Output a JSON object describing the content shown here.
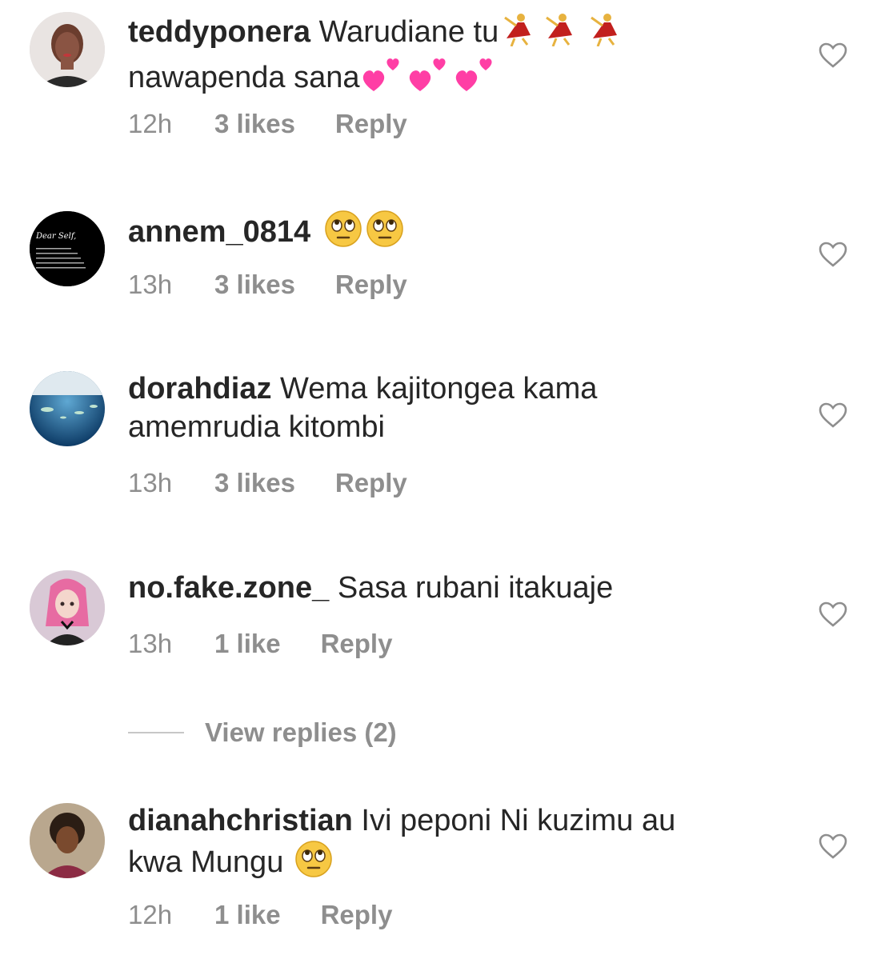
{
  "comments": [
    {
      "username": "teddyponera",
      "text_line1": "Warudiane tu",
      "text_line2": "nawapenda sana",
      "emoji_line1": [
        "dancer",
        "dancer",
        "dancer"
      ],
      "emoji_line2": [
        "two-hearts",
        "two-hearts",
        "two-hearts"
      ],
      "time": "12h",
      "likes": "3 likes",
      "reply": "Reply"
    },
    {
      "username": "annem_0814",
      "text_line1": "",
      "emoji_line1": [
        "rolling-eyes",
        "rolling-eyes"
      ],
      "avatar_title": "Dear Self,",
      "time": "13h",
      "likes": "3 likes",
      "reply": "Reply"
    },
    {
      "username": "dorahdiaz",
      "text_line1": "Wema kajitongea kama",
      "text_line2": "amemrudia kitombi",
      "time": "13h",
      "likes": "3 likes",
      "reply": "Reply"
    },
    {
      "username": "no.fake.zone_",
      "text_line1": "Sasa rubani itakuaje",
      "time": "13h",
      "likes": "1 like",
      "reply": "Reply"
    },
    {
      "username": "dianahchristian",
      "text_line1": "Ivi peponi Ni kuzimu au",
      "text_line2": "kwa Mungu",
      "emoji_line2": [
        "rolling-eyes"
      ],
      "time": "12h",
      "likes": "1 like",
      "reply": "Reply"
    }
  ],
  "view_replies": "View replies (2)",
  "colors": {
    "text": "#262626",
    "meta": "#8e8e8e",
    "heart_stroke": "#8e8e8e"
  }
}
